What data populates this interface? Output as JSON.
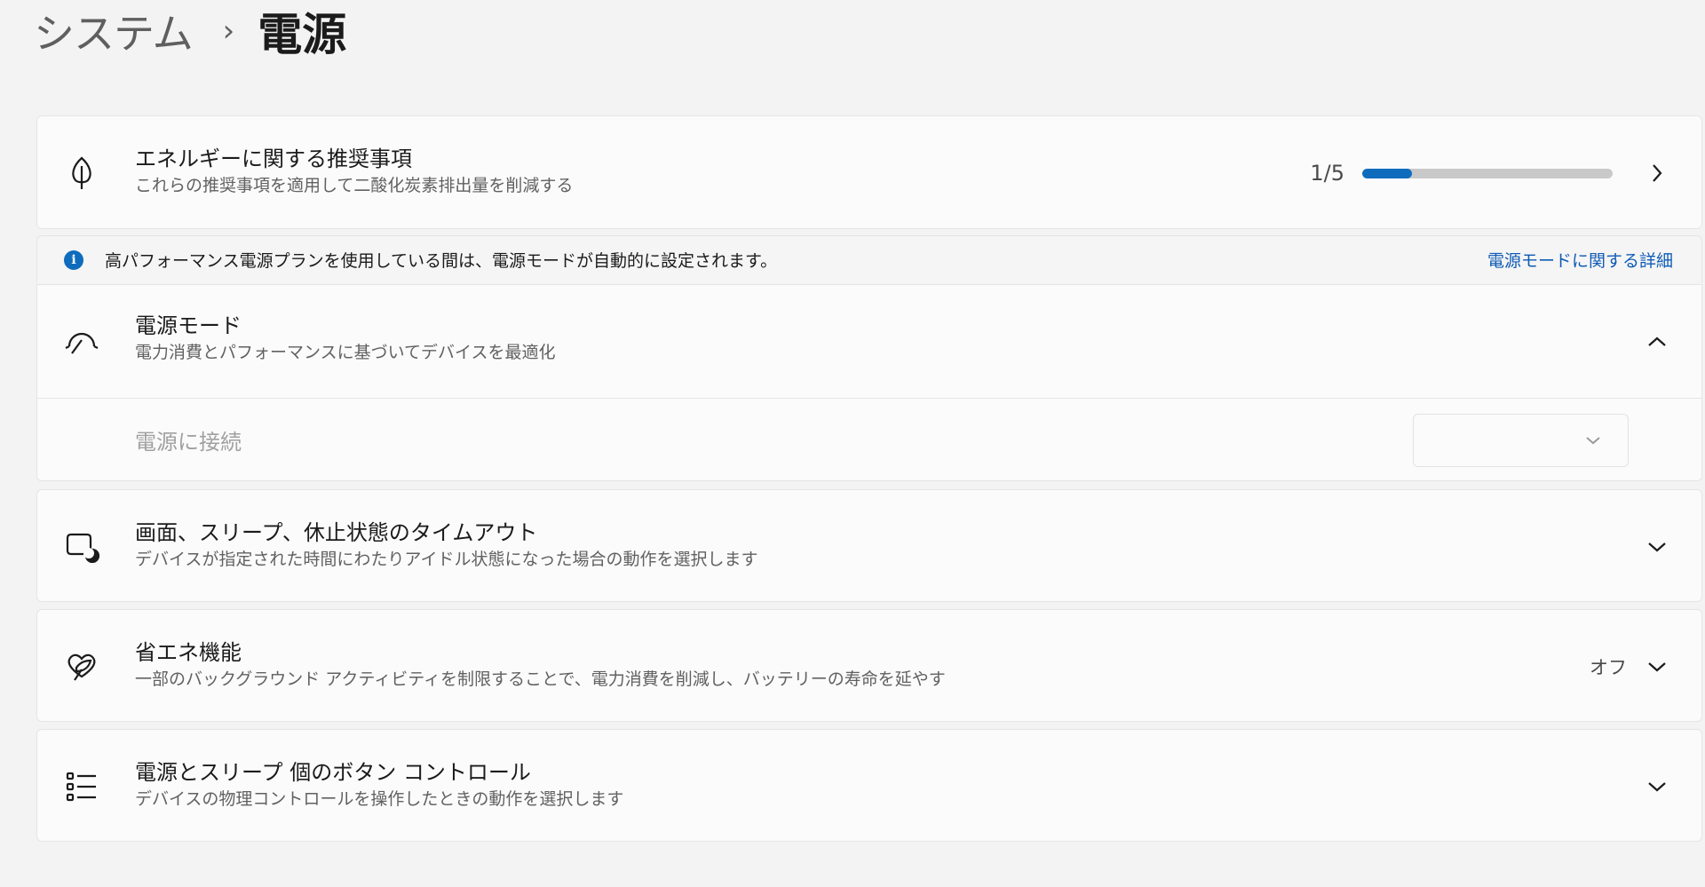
{
  "breadcrumb": {
    "parent": "システム",
    "separator": "›",
    "current": "電源"
  },
  "recommendations": {
    "title": "エネルギーに関する推奨事項",
    "subtitle": "これらの推奨事項を適用して二酸化炭素排出量を削減する",
    "progress_text": "1/5",
    "progress_fraction": 0.2,
    "accent_color": "#0f6cbd"
  },
  "info_bar": {
    "message": "高パフォーマンス電源プランを使用している間は、電源モードが自動的に設定されます。",
    "link": "電源モードに関する詳細"
  },
  "power_mode": {
    "title": "電源モード",
    "subtitle": "電力消費とパフォーマンスに基づいてデバイスを最適化",
    "plugged_in_label": "電源に接続",
    "dropdown_value": ""
  },
  "screen_sleep": {
    "title": "画面、スリープ、休止状態のタイムアウト",
    "subtitle": "デバイスが指定された時間にわたりアイドル状態になった場合の動作を選択します"
  },
  "energy_saver": {
    "title": "省エネ機能",
    "subtitle": "一部のバックグラウンド アクティビティを制限することで、電力消費を削減し、バッテリーの寿命を延やす",
    "state": "オフ"
  },
  "buttons": {
    "title": "電源とスリープ 個のボタン コントロール",
    "subtitle": "デバイスの物理コントロールを操作したときの動作を選択します"
  },
  "icons": {
    "recommendations": "leaf-icon",
    "power_mode": "gauge-icon",
    "screen_sleep": "screen-sleep-icon",
    "energy_saver": "energy-saver-icon",
    "buttons": "list-icon",
    "info": "info-icon"
  }
}
